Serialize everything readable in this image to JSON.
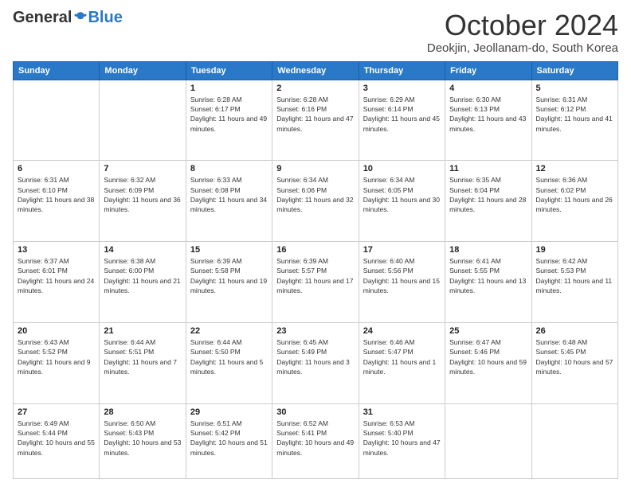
{
  "logo": {
    "general": "General",
    "blue": "Blue"
  },
  "header": {
    "month": "October 2024",
    "location": "Deokjin, Jeollanam-do, South Korea"
  },
  "weekdays": [
    "Sunday",
    "Monday",
    "Tuesday",
    "Wednesday",
    "Thursday",
    "Friday",
    "Saturday"
  ],
  "weeks": [
    [
      {
        "day": null
      },
      {
        "day": null
      },
      {
        "day": "1",
        "sunrise": "Sunrise: 6:28 AM",
        "sunset": "Sunset: 6:17 PM",
        "daylight": "Daylight: 11 hours and 49 minutes."
      },
      {
        "day": "2",
        "sunrise": "Sunrise: 6:28 AM",
        "sunset": "Sunset: 6:16 PM",
        "daylight": "Daylight: 11 hours and 47 minutes."
      },
      {
        "day": "3",
        "sunrise": "Sunrise: 6:29 AM",
        "sunset": "Sunset: 6:14 PM",
        "daylight": "Daylight: 11 hours and 45 minutes."
      },
      {
        "day": "4",
        "sunrise": "Sunrise: 6:30 AM",
        "sunset": "Sunset: 6:13 PM",
        "daylight": "Daylight: 11 hours and 43 minutes."
      },
      {
        "day": "5",
        "sunrise": "Sunrise: 6:31 AM",
        "sunset": "Sunset: 6:12 PM",
        "daylight": "Daylight: 11 hours and 41 minutes."
      }
    ],
    [
      {
        "day": "6",
        "sunrise": "Sunrise: 6:31 AM",
        "sunset": "Sunset: 6:10 PM",
        "daylight": "Daylight: 11 hours and 38 minutes."
      },
      {
        "day": "7",
        "sunrise": "Sunrise: 6:32 AM",
        "sunset": "Sunset: 6:09 PM",
        "daylight": "Daylight: 11 hours and 36 minutes."
      },
      {
        "day": "8",
        "sunrise": "Sunrise: 6:33 AM",
        "sunset": "Sunset: 6:08 PM",
        "daylight": "Daylight: 11 hours and 34 minutes."
      },
      {
        "day": "9",
        "sunrise": "Sunrise: 6:34 AM",
        "sunset": "Sunset: 6:06 PM",
        "daylight": "Daylight: 11 hours and 32 minutes."
      },
      {
        "day": "10",
        "sunrise": "Sunrise: 6:34 AM",
        "sunset": "Sunset: 6:05 PM",
        "daylight": "Daylight: 11 hours and 30 minutes."
      },
      {
        "day": "11",
        "sunrise": "Sunrise: 6:35 AM",
        "sunset": "Sunset: 6:04 PM",
        "daylight": "Daylight: 11 hours and 28 minutes."
      },
      {
        "day": "12",
        "sunrise": "Sunrise: 6:36 AM",
        "sunset": "Sunset: 6:02 PM",
        "daylight": "Daylight: 11 hours and 26 minutes."
      }
    ],
    [
      {
        "day": "13",
        "sunrise": "Sunrise: 6:37 AM",
        "sunset": "Sunset: 6:01 PM",
        "daylight": "Daylight: 11 hours and 24 minutes."
      },
      {
        "day": "14",
        "sunrise": "Sunrise: 6:38 AM",
        "sunset": "Sunset: 6:00 PM",
        "daylight": "Daylight: 11 hours and 21 minutes."
      },
      {
        "day": "15",
        "sunrise": "Sunrise: 6:39 AM",
        "sunset": "Sunset: 5:58 PM",
        "daylight": "Daylight: 11 hours and 19 minutes."
      },
      {
        "day": "16",
        "sunrise": "Sunrise: 6:39 AM",
        "sunset": "Sunset: 5:57 PM",
        "daylight": "Daylight: 11 hours and 17 minutes."
      },
      {
        "day": "17",
        "sunrise": "Sunrise: 6:40 AM",
        "sunset": "Sunset: 5:56 PM",
        "daylight": "Daylight: 11 hours and 15 minutes."
      },
      {
        "day": "18",
        "sunrise": "Sunrise: 6:41 AM",
        "sunset": "Sunset: 5:55 PM",
        "daylight": "Daylight: 11 hours and 13 minutes."
      },
      {
        "day": "19",
        "sunrise": "Sunrise: 6:42 AM",
        "sunset": "Sunset: 5:53 PM",
        "daylight": "Daylight: 11 hours and 11 minutes."
      }
    ],
    [
      {
        "day": "20",
        "sunrise": "Sunrise: 6:43 AM",
        "sunset": "Sunset: 5:52 PM",
        "daylight": "Daylight: 11 hours and 9 minutes."
      },
      {
        "day": "21",
        "sunrise": "Sunrise: 6:44 AM",
        "sunset": "Sunset: 5:51 PM",
        "daylight": "Daylight: 11 hours and 7 minutes."
      },
      {
        "day": "22",
        "sunrise": "Sunrise: 6:44 AM",
        "sunset": "Sunset: 5:50 PM",
        "daylight": "Daylight: 11 hours and 5 minutes."
      },
      {
        "day": "23",
        "sunrise": "Sunrise: 6:45 AM",
        "sunset": "Sunset: 5:49 PM",
        "daylight": "Daylight: 11 hours and 3 minutes."
      },
      {
        "day": "24",
        "sunrise": "Sunrise: 6:46 AM",
        "sunset": "Sunset: 5:47 PM",
        "daylight": "Daylight: 11 hours and 1 minute."
      },
      {
        "day": "25",
        "sunrise": "Sunrise: 6:47 AM",
        "sunset": "Sunset: 5:46 PM",
        "daylight": "Daylight: 10 hours and 59 minutes."
      },
      {
        "day": "26",
        "sunrise": "Sunrise: 6:48 AM",
        "sunset": "Sunset: 5:45 PM",
        "daylight": "Daylight: 10 hours and 57 minutes."
      }
    ],
    [
      {
        "day": "27",
        "sunrise": "Sunrise: 6:49 AM",
        "sunset": "Sunset: 5:44 PM",
        "daylight": "Daylight: 10 hours and 55 minutes."
      },
      {
        "day": "28",
        "sunrise": "Sunrise: 6:50 AM",
        "sunset": "Sunset: 5:43 PM",
        "daylight": "Daylight: 10 hours and 53 minutes."
      },
      {
        "day": "29",
        "sunrise": "Sunrise: 6:51 AM",
        "sunset": "Sunset: 5:42 PM",
        "daylight": "Daylight: 10 hours and 51 minutes."
      },
      {
        "day": "30",
        "sunrise": "Sunrise: 6:52 AM",
        "sunset": "Sunset: 5:41 PM",
        "daylight": "Daylight: 10 hours and 49 minutes."
      },
      {
        "day": "31",
        "sunrise": "Sunrise: 6:53 AM",
        "sunset": "Sunset: 5:40 PM",
        "daylight": "Daylight: 10 hours and 47 minutes."
      },
      {
        "day": null
      },
      {
        "day": null
      }
    ]
  ]
}
